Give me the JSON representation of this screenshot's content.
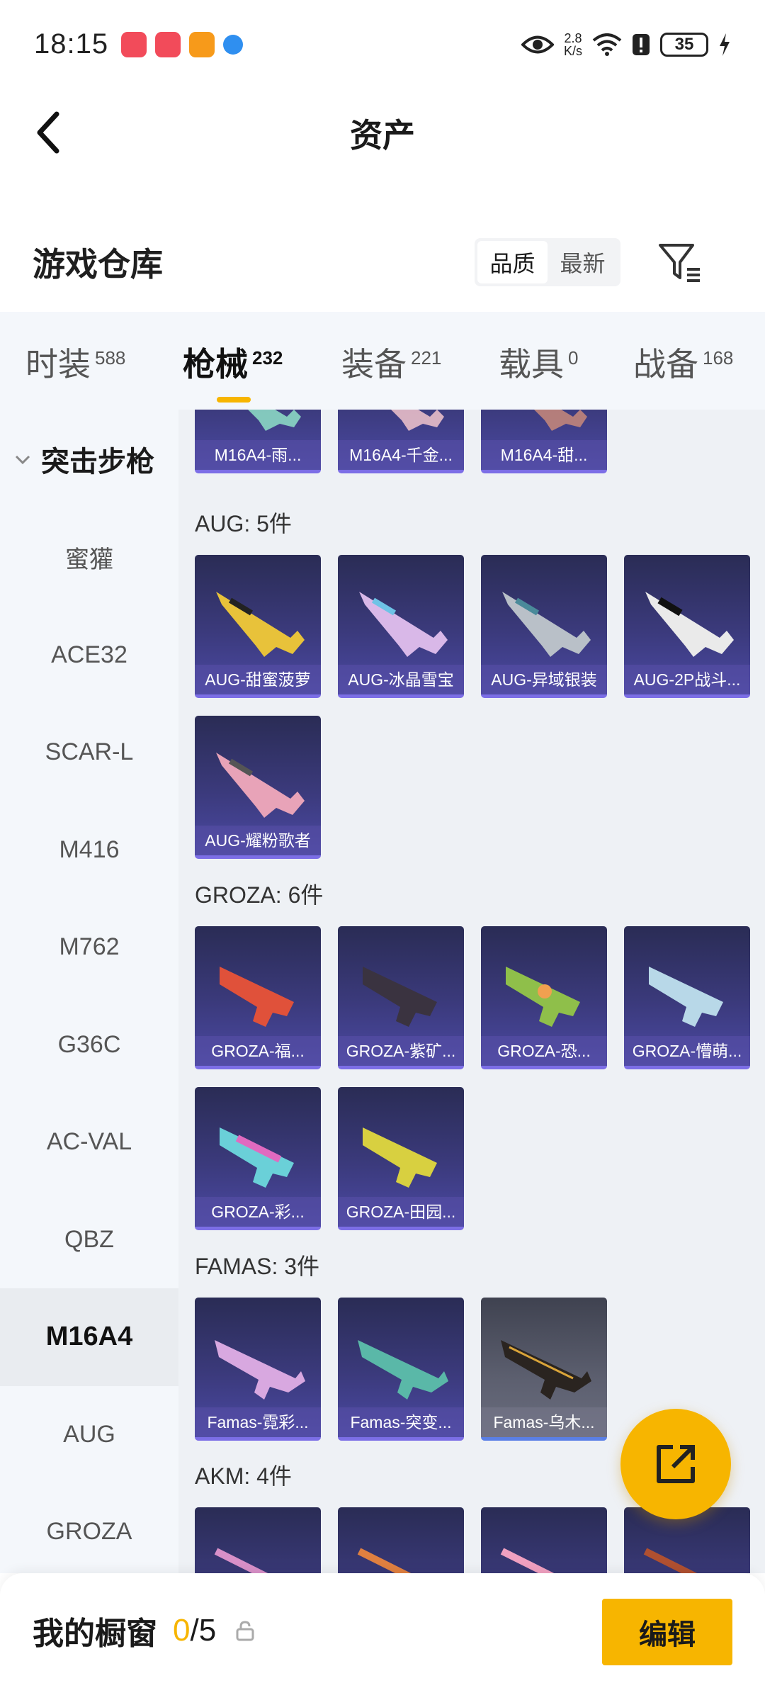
{
  "status_bar": {
    "time": "18:15",
    "speed_value": "2.8",
    "speed_unit": "K/s",
    "battery": "35",
    "app_icon_colors": [
      "#f24b5a",
      "#f24b5a",
      "#f79a1a",
      "#2f8ff0"
    ]
  },
  "header": {
    "title": "资产"
  },
  "warehouse": {
    "title": "游戏仓库",
    "sort_options": [
      "品质",
      "最新"
    ],
    "active_sort": "品质"
  },
  "tabs": [
    {
      "label": "时装",
      "count": "588"
    },
    {
      "label": "枪械",
      "count": "232",
      "active": true
    },
    {
      "label": "装备",
      "count": "221"
    },
    {
      "label": "载具",
      "count": "0"
    },
    {
      "label": "战备",
      "count": "168"
    }
  ],
  "sidebar": {
    "group": "突击步枪",
    "items": [
      "蜜獾",
      "ACE32",
      "SCAR-L",
      "M416",
      "M762",
      "G36C",
      "AC-VAL",
      "QBZ",
      "M16A4",
      "AUG",
      "GROZA"
    ],
    "active_item": "M16A4"
  },
  "sections": {
    "m16a4_partial": [
      "M16A4-雨...",
      "M16A4-千金...",
      "M16A4-甜..."
    ],
    "aug": {
      "header": "AUG: 5件",
      "items": [
        "AUG-甜蜜菠萝",
        "AUG-冰晶雪宝",
        "AUG-异域银装",
        "AUG-2P战斗...",
        "AUG-耀粉歌者"
      ]
    },
    "groza": {
      "header": "GROZA: 6件",
      "items": [
        "GROZA-福...",
        "GROZA-紫矿...",
        "GROZA-恐...",
        "GROZA-懵萌...",
        "GROZA-彩...",
        "GROZA-田园..."
      ]
    },
    "famas": {
      "header": "FAMAS: 3件",
      "items": [
        "Famas-霓彩...",
        "Famas-突变...",
        "Famas-乌木..."
      ]
    },
    "akm": {
      "header": "AKM: 4件"
    }
  },
  "bottom_bar": {
    "title": "我的橱窗",
    "count_current": "0",
    "count_total": "/5",
    "edit_label": "编辑"
  },
  "colors": {
    "accent": "#f7b500",
    "card": "#3b3a7c"
  }
}
